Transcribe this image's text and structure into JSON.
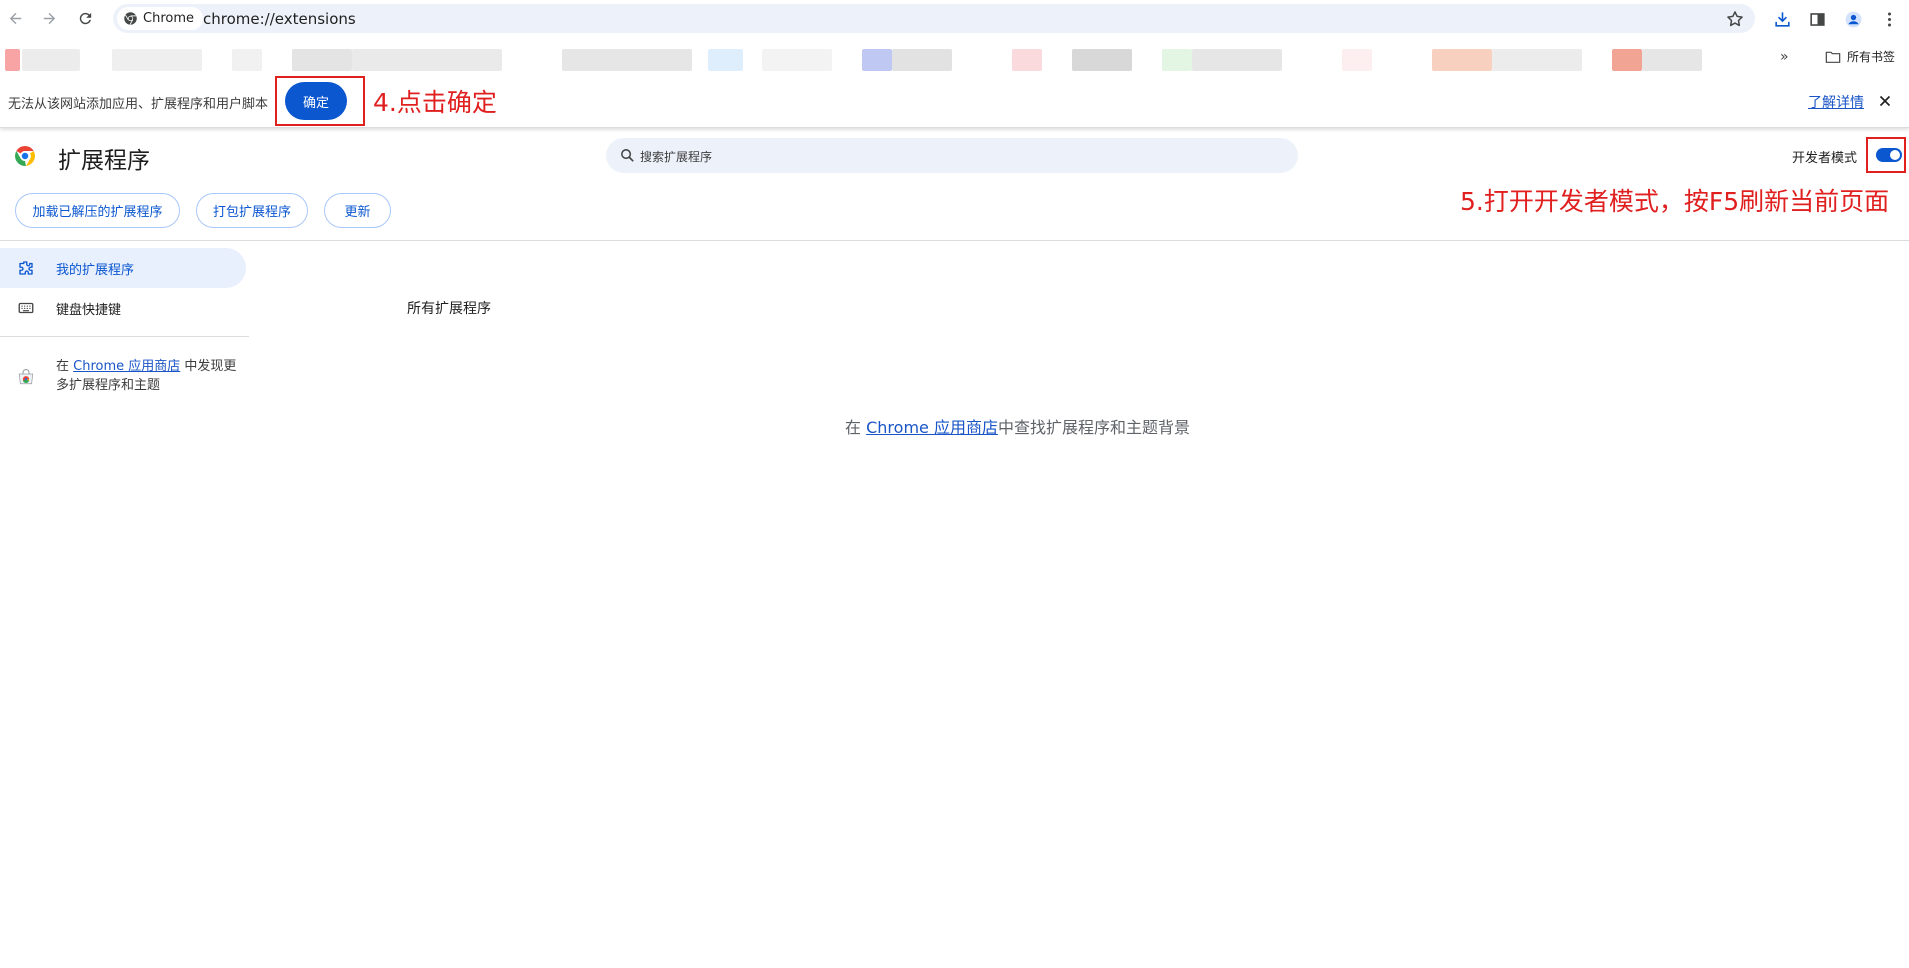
{
  "browser": {
    "site_chip_label": "Chrome",
    "url": "chrome://extensions",
    "bookmarks_all_label": "所有书签",
    "bookmarks_more": "»"
  },
  "infobar": {
    "message": "无法从该网站添加应用、扩展程序和用户脚本",
    "ok_label": "确定",
    "learn_more": "了解详情"
  },
  "annotations": {
    "step4": "4.点击确定",
    "step5": "5.打开开发者模式，按F5刷新当前页面",
    "color": "#e01f1f"
  },
  "header": {
    "title": "扩展程序",
    "search_placeholder": "搜索扩展程序",
    "dev_mode_label": "开发者模式",
    "dev_mode_on": true
  },
  "actions": {
    "load_unpacked": "加载已解压的扩展程序",
    "pack": "打包扩展程序",
    "update": "更新"
  },
  "sidebar": {
    "items": [
      {
        "label": "我的扩展程序",
        "icon": "puzzle-icon",
        "active": true
      },
      {
        "label": "键盘快捷键",
        "icon": "keyboard-icon",
        "active": false
      }
    ],
    "store_prefix": "在",
    "store_link": "Chrome 应用商店",
    "store_suffix": "中发现更多扩展程序和主题"
  },
  "main": {
    "section_title": "所有扩展程序",
    "empty_prefix": "在",
    "empty_link": "Chrome 应用商店",
    "empty_suffix": "中查找扩展程序和主题背景"
  },
  "colors": {
    "accent": "#0b57d0",
    "link": "#1a55c7",
    "active_bg": "#e8effd",
    "annotation_red": "#e01f1f"
  }
}
